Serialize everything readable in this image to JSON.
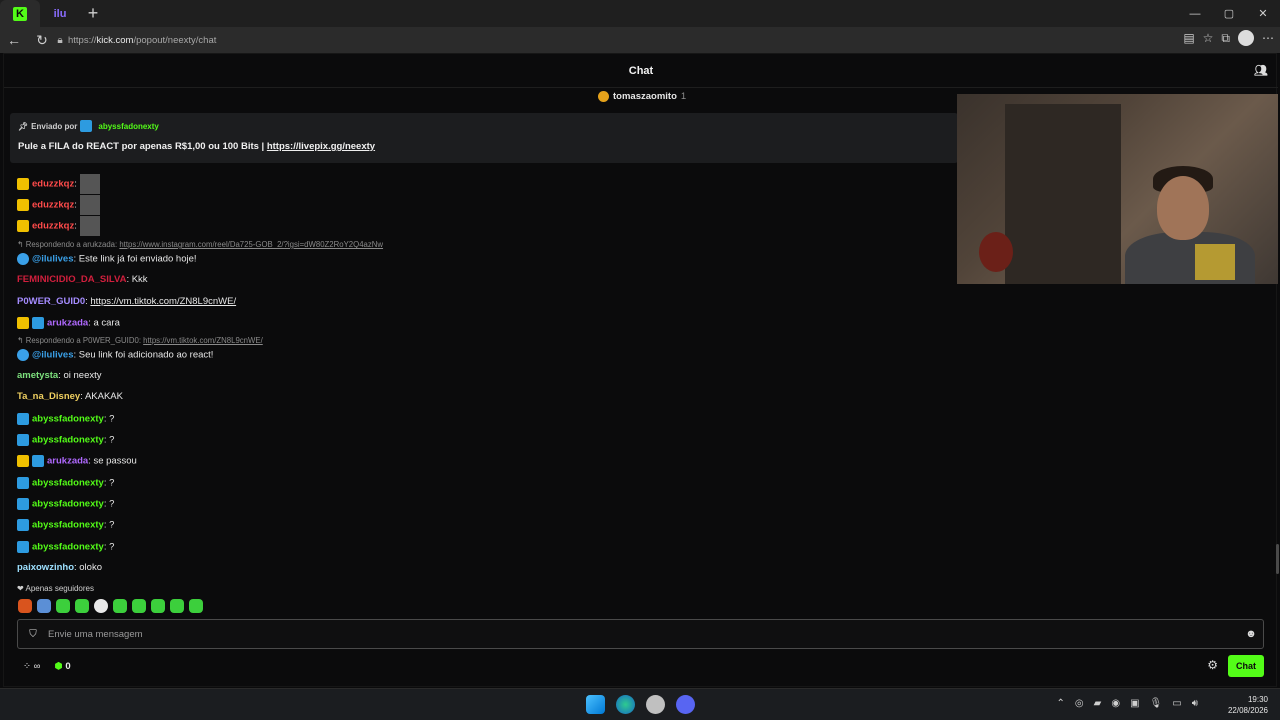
{
  "browser": {
    "tabs": [
      {
        "icon": "kick-logo-icon",
        "label": "K"
      },
      {
        "icon": "ilu-logo-icon",
        "label": "ilu"
      }
    ],
    "new_tab": "+",
    "url_prefix": "https://",
    "url_host": "kick.com",
    "url_path": "/popout/neexty/chat",
    "window_controls": [
      "—",
      "▢",
      "✕"
    ]
  },
  "chat": {
    "title": "Chat",
    "pinned_user": {
      "name": "tomaszaomito",
      "count": "1"
    },
    "pinned_message": {
      "sent_by_label": "Enviado por",
      "sent_by_user": "abyssfadonexty",
      "text": "Pule a FILA do REACT por apenas R$1,00 ou 100 Bits | ",
      "link": "https://livepix.gg/neexty"
    },
    "messages": [
      {
        "user": "eduzzkqz",
        "color": "#ff4b4b",
        "badges": [
          "yellow"
        ],
        "text": ":",
        "image": true
      },
      {
        "user": "eduzzkqz",
        "color": "#ff4b4b",
        "badges": [
          "yellow"
        ],
        "text": ":",
        "image": true
      },
      {
        "user": "eduzzkqz",
        "color": "#ff4b4b",
        "badges": [
          "yellow"
        ],
        "text": ":",
        "image": true
      },
      {
        "reply_label": "Respondendo a arukzada:",
        "reply_link": "https://www.instagram.com/reel/Da725-GOB_2/?igsi=dW80Z2RoY2Q4azNw"
      },
      {
        "user": "@ilulives",
        "color": "#3aa0e8",
        "badges": [
          "bot"
        ],
        "text": ": Este link já foi enviado hoje!"
      },
      {
        "user": "FEMINICIDIO_DA_SILVA",
        "color": "#d11f3d",
        "badges": [],
        "text": ": Kkk"
      },
      {
        "user": "P0WER_GUID0",
        "color": "#a58cff",
        "badges": [],
        "text": ": ",
        "link": "https://vm.tiktok.com/ZN8L9cnWE/"
      },
      {
        "user": "arukzada",
        "color": "#b069ff",
        "badges": [
          "yellow",
          "blue"
        ],
        "text": ": a cara"
      },
      {
        "reply_label": "Respondendo a P0WER_GUID0:",
        "reply_link": "https://vm.tiktok.com/ZN8L9cnWE/"
      },
      {
        "user": "@ilulives",
        "color": "#3aa0e8",
        "badges": [
          "bot"
        ],
        "text": ": Seu link foi adicionado ao react!"
      },
      {
        "user": "ametysta",
        "color": "#7de07d",
        "badges": [],
        "text": ": oi neexty"
      },
      {
        "user": "Ta_na_Disney",
        "color": "#f0d060",
        "badges": [],
        "text": ": AKAKAK"
      },
      {
        "user": "abyssfadonexty",
        "color": "#53fc18",
        "badges": [
          "blue"
        ],
        "text": ": ?"
      },
      {
        "user": "abyssfadonexty",
        "color": "#53fc18",
        "badges": [
          "blue"
        ],
        "text": ": ?"
      },
      {
        "user": "arukzada",
        "color": "#b069ff",
        "badges": [
          "yellow",
          "blue"
        ],
        "text": ": se passou"
      },
      {
        "user": "abyssfadonexty",
        "color": "#53fc18",
        "badges": [
          "blue"
        ],
        "text": ": ?"
      },
      {
        "user": "abyssfadonexty",
        "color": "#53fc18",
        "badges": [
          "blue"
        ],
        "text": ": ?"
      },
      {
        "user": "abyssfadonexty",
        "color": "#53fc18",
        "badges": [
          "blue"
        ],
        "text": ": ?"
      },
      {
        "user": "abyssfadonexty",
        "color": "#53fc18",
        "badges": [
          "blue"
        ],
        "text": ": ?"
      },
      {
        "user": "paixowzinho",
        "color": "#9de0ff",
        "badges": [],
        "text": ": oloko"
      }
    ],
    "followers_only": "Apenas seguidores",
    "input_placeholder": "Envie uma mensagem",
    "bits_count": "0",
    "send_button": "Chat",
    "accent": "#53fc18"
  },
  "taskbar": {
    "time": "19:30",
    "date": "22/08/2026"
  }
}
